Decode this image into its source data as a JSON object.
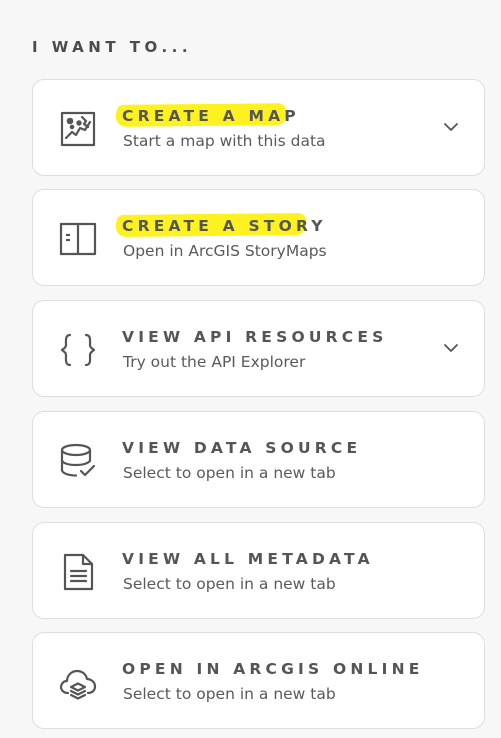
{
  "section": {
    "heading": "I WANT TO..."
  },
  "highlight_color": "#fdf220",
  "actions": [
    {
      "title": "CREATE A MAP",
      "subtitle": "Start a map with this data",
      "icon": "map-icon",
      "has_dropdown": true,
      "highlighted": true
    },
    {
      "title": "CREATE A STORY",
      "subtitle": "Open in ArcGIS StoryMaps",
      "icon": "story-icon",
      "has_dropdown": false,
      "highlighted": true
    },
    {
      "title": "VIEW API RESOURCES",
      "subtitle": "Try out the API Explorer",
      "icon": "code-braces-icon",
      "has_dropdown": true,
      "highlighted": false
    },
    {
      "title": "VIEW DATA SOURCE",
      "subtitle": "Select to open in a new tab",
      "icon": "database-check-icon",
      "has_dropdown": false,
      "highlighted": false
    },
    {
      "title": "VIEW ALL METADATA",
      "subtitle": "Select to open in a new tab",
      "icon": "document-icon",
      "has_dropdown": false,
      "highlighted": false
    },
    {
      "title": "OPEN IN ARCGIS ONLINE",
      "subtitle": "Select to open in a new tab",
      "icon": "cloud-layers-icon",
      "has_dropdown": false,
      "highlighted": false
    }
  ]
}
